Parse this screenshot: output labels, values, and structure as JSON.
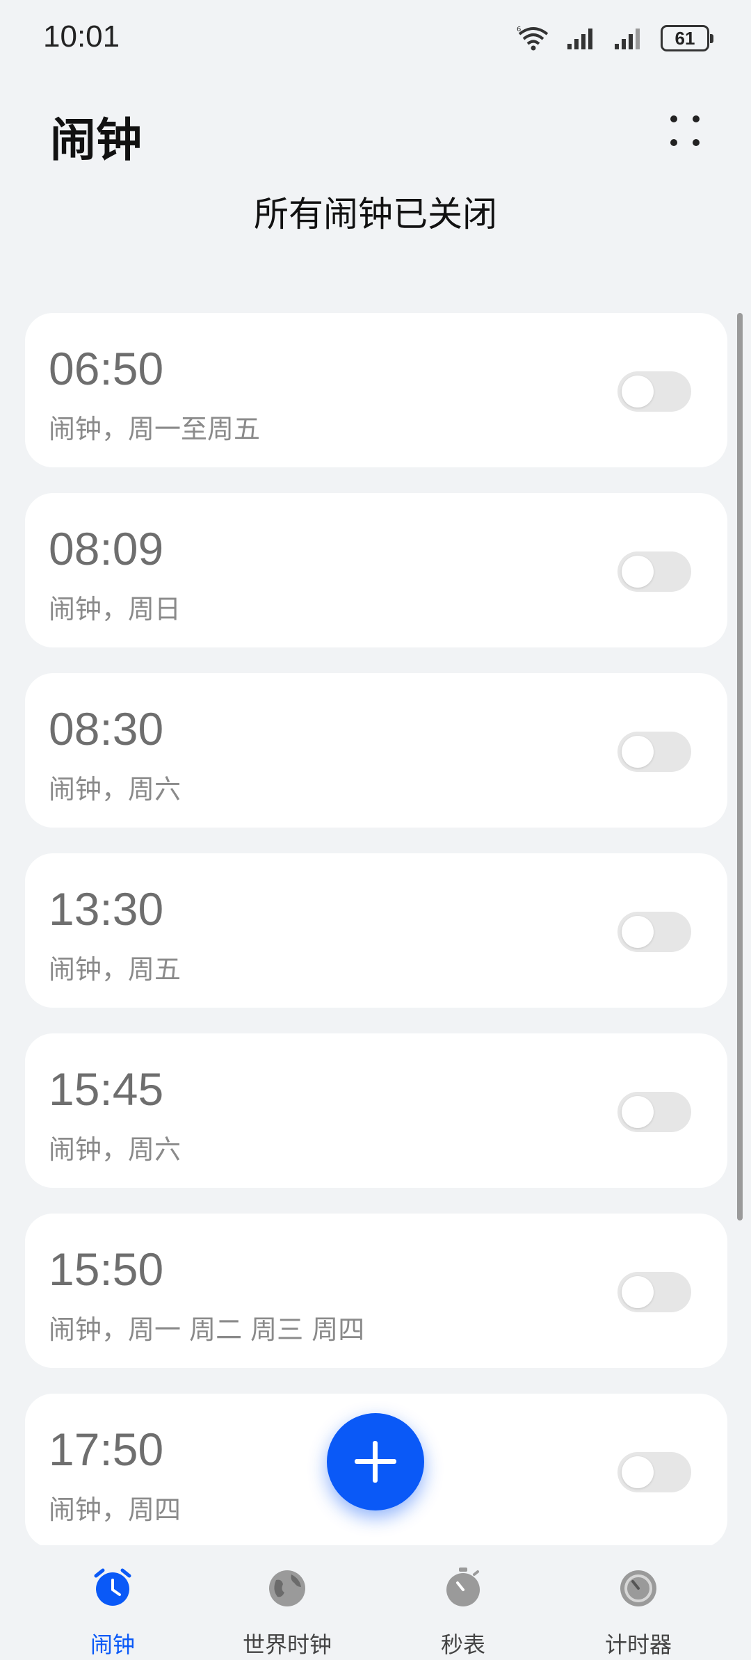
{
  "status_bar": {
    "time": "10:01",
    "battery": "61",
    "icons": [
      "wifi-6-icon",
      "signal-icon",
      "signal-icon",
      "battery-icon"
    ]
  },
  "header": {
    "title": "闹钟",
    "more_icon": "more-dots-icon",
    "status": "所有闹钟已关闭"
  },
  "alarms": [
    {
      "time": "06:50",
      "desc": "闹钟，周一至周五",
      "enabled": false
    },
    {
      "time": "08:09",
      "desc": "闹钟，周日",
      "enabled": false
    },
    {
      "time": "08:30",
      "desc": "闹钟，周六",
      "enabled": false
    },
    {
      "time": "13:30",
      "desc": "闹钟，周五",
      "enabled": false
    },
    {
      "time": "15:45",
      "desc": "闹钟，周六",
      "enabled": false
    },
    {
      "time": "15:50",
      "desc": "闹钟，周一 周二 周三 周四",
      "enabled": false
    },
    {
      "time": "17:50",
      "desc": "闹钟，周四",
      "enabled": false
    }
  ],
  "fab": {
    "icon": "plus-icon"
  },
  "bottom_nav": [
    {
      "label": "闹钟",
      "icon": "alarm-clock-icon",
      "active": true
    },
    {
      "label": "世界时钟",
      "icon": "globe-icon",
      "active": false
    },
    {
      "label": "秒表",
      "icon": "stopwatch-icon",
      "active": false
    },
    {
      "label": "计时器",
      "icon": "timer-icon",
      "active": false
    }
  ],
  "colors": {
    "accent": "#0a59f7",
    "background": "#f1f3f5",
    "card": "#ffffff",
    "toggle_off": "#e6e6e6"
  }
}
